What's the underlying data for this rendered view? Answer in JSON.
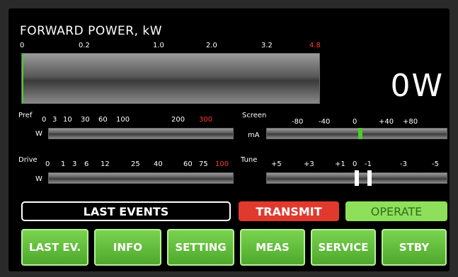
{
  "forward_power": {
    "title": "FORWARD POWER, kW",
    "ticks": [
      "0",
      "0.2",
      "1.0",
      "2.0",
      "3.2",
      "4.8"
    ],
    "level_fraction": 0.0,
    "readout": "0W"
  },
  "pref": {
    "label": "Pref",
    "unit": "W",
    "ticks": [
      "0",
      "3",
      "10",
      "30",
      "60",
      "100",
      "200",
      "300"
    ],
    "level_fraction": 0.0
  },
  "drive": {
    "label": "Drive",
    "unit": "W",
    "ticks": [
      "0",
      "1",
      "3",
      "6",
      "12",
      "25",
      "40",
      "60",
      "75",
      "100"
    ],
    "level_fraction": 0.0
  },
  "screen": {
    "label": "Screen",
    "unit": "mA",
    "ticks": [
      "-80",
      "-40",
      "0",
      "+40",
      "+80"
    ],
    "value": 0
  },
  "tune": {
    "label": "Tune",
    "ticks": [
      "+5",
      "+3",
      "+1",
      "0",
      "-1",
      "-3",
      "-5"
    ],
    "value": 0
  },
  "events_label": "LAST EVENTS",
  "status": {
    "transmit": "TRANSMIT",
    "operate": "OPERATE"
  },
  "buttons": {
    "last_ev": "LAST EV.",
    "info": "INFO",
    "setting": "SETTING",
    "meas": "MEAS",
    "service": "SERVICE",
    "stby": "STBY"
  },
  "colors": {
    "meter_fill": "#4ccc2a",
    "limit_tick": "#ff3b30",
    "transmit_bg": "#e03a2e",
    "operate_bg": "#8ee05a",
    "button_bg": "#5fbf3a"
  }
}
